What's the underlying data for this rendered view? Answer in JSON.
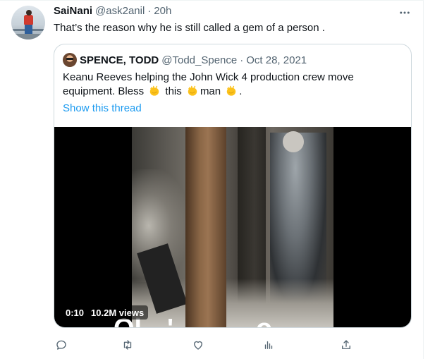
{
  "tweet": {
    "display_name": "SaiNani",
    "handle": "@ask2anil",
    "separator": "·",
    "time": "20h",
    "text": "That’s the reason why he is still called a gem of a person .",
    "more_icon": "more-horizontal-icon"
  },
  "quoted": {
    "display_name": "SPENCE, TODD",
    "handle": "@Todd_Spence",
    "separator": "·",
    "date": "Oct 28, 2021",
    "text_part1": "Keanu Reeves helping the John Wick 4 production crew move equipment. Bless",
    "text_part2": "this",
    "text_part3": "man",
    "text_part4": ".",
    "show_thread": "Show this thread",
    "video": {
      "timestamp": "0:10",
      "views": "10.2M views",
      "caption_fragments": [
        "Ol",
        "'",
        "o"
      ]
    }
  },
  "actions": {
    "reply_icon": "reply-icon",
    "retweet_icon": "retweet-icon",
    "like_icon": "like-icon",
    "views_icon": "views-icon",
    "share_icon": "share-icon"
  },
  "colors": {
    "text": "#0f1419",
    "secondary": "#536471",
    "link": "#1d9bf0",
    "border": "#cfd9de"
  }
}
